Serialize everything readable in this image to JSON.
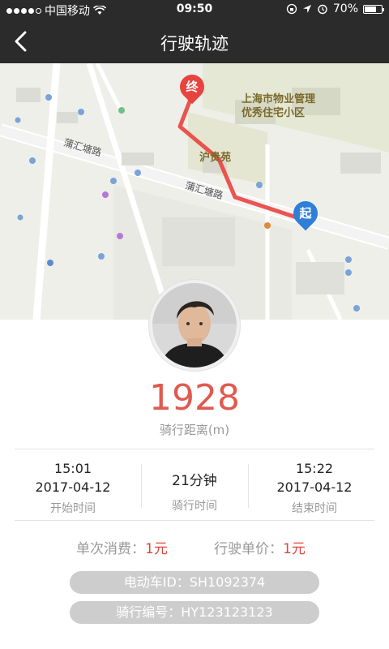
{
  "status_bar": {
    "carrier": "中国移动",
    "time": "09:50",
    "battery": "70%",
    "battery_level": 0.7
  },
  "nav": {
    "title": "行驶轨迹"
  },
  "map": {
    "pin_end": "终",
    "pin_start": "起",
    "labels": {
      "community": "上海市物业管理\n优秀住宅小区",
      "huguiyuan": "沪贵苑",
      "pujiang_road_1": "蒲汇塘路",
      "pujiang_road_2": "蒲汇塘路"
    }
  },
  "ride": {
    "distance": "1928",
    "distance_label": "骑行距离(m)",
    "start_time": "15:01",
    "start_date": "2017-04-12",
    "start_label": "开始时间",
    "duration": "21分钟",
    "duration_label": "骑行时间",
    "end_time": "15:22",
    "end_date": "2017-04-12",
    "end_label": "结束时间"
  },
  "fees": {
    "single_label": "单次消费：",
    "single_value": "1元",
    "unit_label": "行驶单价：",
    "unit_value": "1元"
  },
  "ids": {
    "vehicle": "电动车ID：SH1092374",
    "ride_no": "骑行编号：HY123123123"
  },
  "colors": {
    "header": "#2b2b2b",
    "accent_red": "#e05a4f",
    "pin_start": "#2f7ed8",
    "route": "#e9433f"
  }
}
